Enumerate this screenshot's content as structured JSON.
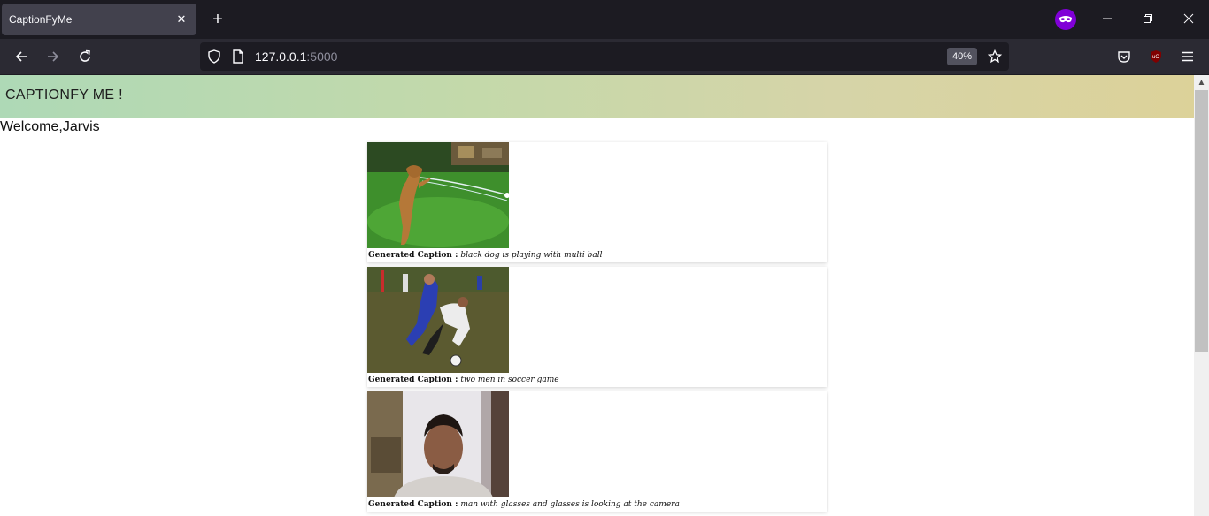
{
  "browser": {
    "tab_title": "CaptionFyMe",
    "tab_close_glyph": "✕",
    "new_tab_glyph": "+",
    "url_host": "127.0.0.1",
    "url_port": ":5000",
    "zoom": "40%",
    "icons": [
      "back-icon",
      "forward-icon",
      "reload-icon",
      "shield-icon",
      "page-icon",
      "star-icon",
      "pocket-icon",
      "ublock-icon",
      "menu-icon",
      "private-browsing-icon",
      "minimize-icon",
      "restore-icon",
      "close-window-icon"
    ]
  },
  "page": {
    "site_title": "CAPTIONFY ME !",
    "welcome": "Welcome,Jarvis",
    "caption_label": "Generated Caption :",
    "cards": [
      {
        "image": "dog",
        "caption": "black dog is playing with multi ball"
      },
      {
        "image": "soccer",
        "caption": "two men in soccer game"
      },
      {
        "image": "selfie",
        "caption": "man with glasses and glasses is looking at the camera"
      }
    ]
  },
  "colors": {
    "header_gradient_start": "#aed9b6",
    "header_gradient_end": "#dcd299",
    "chrome_dark": "#1c1b22",
    "toolbar": "#2b2a33"
  }
}
